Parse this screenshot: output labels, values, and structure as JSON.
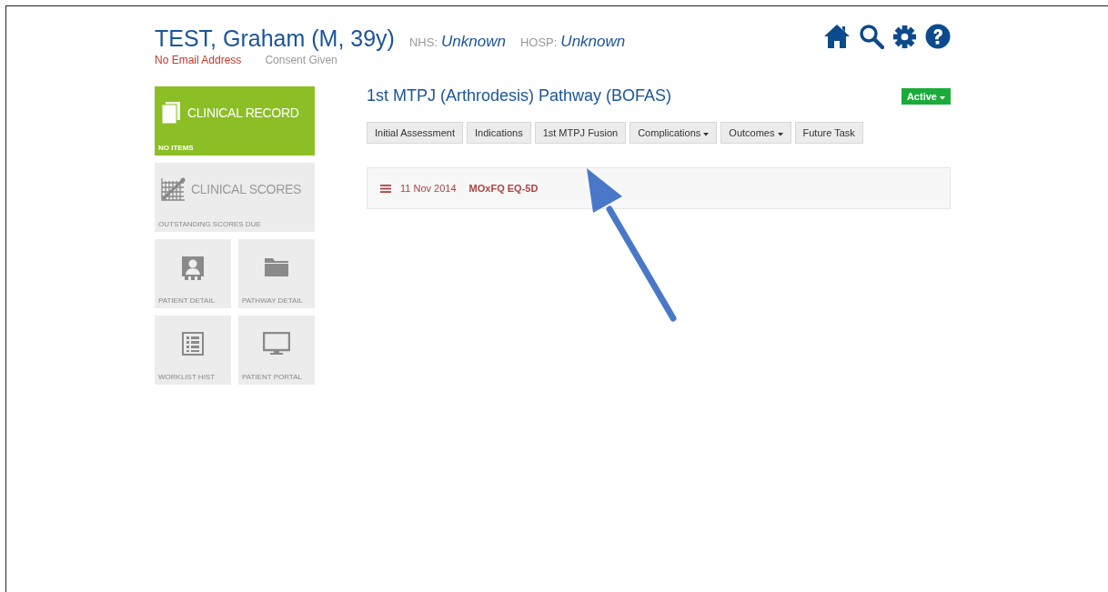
{
  "patient": {
    "name": "TEST, Graham (M, 39y)",
    "ids": [
      {
        "label": "NHS:",
        "value": "Unknown"
      },
      {
        "label": "HOSP:",
        "value": "Unknown"
      }
    ],
    "email_status": "No Email Address",
    "consent": "Consent Given"
  },
  "toolbar": [
    {
      "kind": "home"
    },
    {
      "kind": "search"
    },
    {
      "kind": "settings"
    },
    {
      "kind": "help"
    }
  ],
  "tiles": [
    {
      "kind": "record",
      "highlight": true,
      "title": "CLINICAL RECORD",
      "caption": "NO ITEMS"
    },
    {
      "kind": "scores",
      "highlight": false,
      "title": "CLINICAL SCORES",
      "caption": "OUTSTANDING SCORES DUE"
    },
    {
      "kind": "patient",
      "highlight": false,
      "caption": "PATIENT DETAIL"
    },
    {
      "kind": "folder",
      "highlight": false,
      "caption": "PATHWAY DETAIL"
    },
    {
      "kind": "list",
      "highlight": false,
      "caption": "WORKLIST HIST"
    },
    {
      "kind": "monitor",
      "highlight": false,
      "caption": "PATIENT PORTAL"
    }
  ],
  "pathway": {
    "title": "1st MTPJ (Arthrodesis) Pathway (BOFAS)",
    "status": "Active",
    "tabs": [
      {
        "label": "Initial Assessment",
        "kind": "plain"
      },
      {
        "label": "Indications",
        "kind": "plain"
      },
      {
        "label": "1st MTPJ Fusion",
        "kind": "plain"
      },
      {
        "label": "Complications",
        "kind": "dropdown"
      },
      {
        "label": "Outcomes",
        "kind": "dropdown"
      },
      {
        "label": "Future Task",
        "kind": "plain"
      }
    ],
    "entries": [
      {
        "date": "11 Nov 2014",
        "title": "MOxFQ EQ-5D"
      }
    ]
  },
  "annotation": {
    "kind": "arrow"
  }
}
